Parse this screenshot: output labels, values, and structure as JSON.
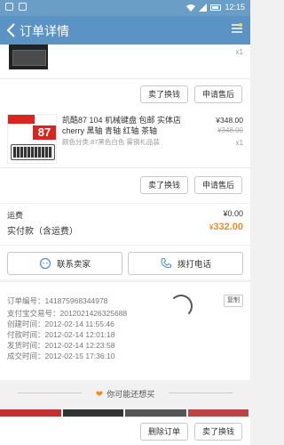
{
  "status_bar": {
    "time": "12:15"
  },
  "nav": {
    "title": "订单详情"
  },
  "item1": {
    "qty": "x1",
    "sell_label": "卖了换钱",
    "aftersale_label": "申请售后"
  },
  "item2": {
    "image_number": "87",
    "title": "凯酷87 104 机械键盘 包邮 实体店 cherry 黑轴 青轴 红轴 茶轴",
    "spec": "颜色分类:87黑色白色 雾钢礼品装",
    "price": "¥348.00",
    "original_price": "¥348.00",
    "qty": "x1",
    "sell_label": "卖了换钱",
    "aftersale_label": "申请售后"
  },
  "summary": {
    "shipping_label": "运费",
    "shipping_value": "¥0.00",
    "total_label": "实付款（含运费）",
    "total_currency": "¥",
    "total_value": "332.00"
  },
  "contact": {
    "seller_label": "联系卖家",
    "call_label": "拨打电话"
  },
  "order_info": {
    "lines": [
      "订单编号：141875968344978",
      "支付宝交易号：2012021426325688",
      "创建时间：2012-02-14 11:55:46",
      "付款时间：2012-02-14 12:01:18",
      "发货时间：2012-02-14 12:23:58",
      "成交时间：2012-02-15 17:36:10"
    ],
    "copy_label": "复制"
  },
  "recommend": {
    "label": "你可能还想买"
  },
  "bottom": {
    "delete_label": "删除订单",
    "sell_label": "卖了换钱"
  },
  "colors": {
    "nav_bg": "#5b93c5",
    "accent_orange": "#f08a1d",
    "price_red": "#d9251d"
  }
}
